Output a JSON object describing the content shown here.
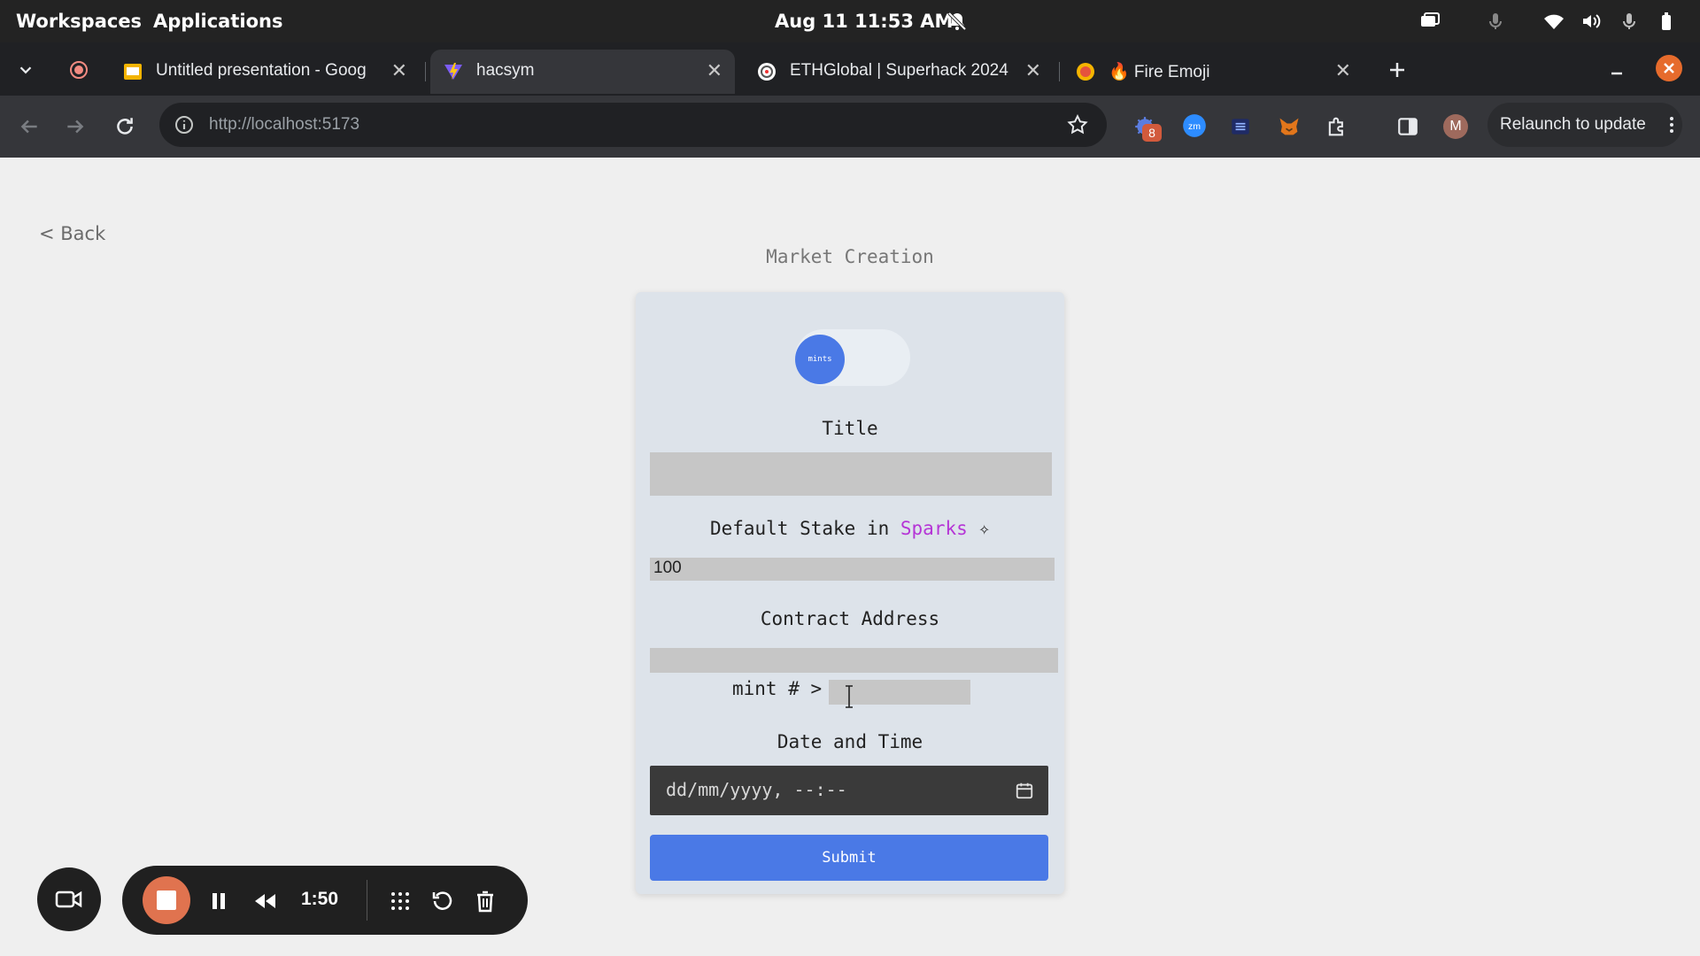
{
  "system_bar": {
    "workspaces": "Workspaces",
    "applications": "Applications",
    "clock": "Aug 11  11:53 AM"
  },
  "tabs": [
    {
      "title": "Untitled presentation - Goog",
      "favicon": "slides-icon",
      "active": false
    },
    {
      "title": "hacsym",
      "favicon": "vite-icon",
      "active": true
    },
    {
      "title": "ETHGlobal | Superhack 2024",
      "favicon": "ethglobal-icon",
      "active": false
    },
    {
      "title": "🔥 Fire Emoji",
      "favicon": "emoji-icon",
      "active": false
    }
  ],
  "toolbar": {
    "url": "http://localhost:5173",
    "relaunch_label": "Relaunch to update",
    "extension_badge": "8",
    "profile_initial": "M"
  },
  "page": {
    "back_link": "< Back",
    "title": "Market Creation",
    "toggle_label": "mints",
    "title_label": "Title",
    "title_value": "",
    "stake_label_prefix": "Default Stake in ",
    "stake_label_currency": "Sparks",
    "stake_label_suffix": " ✧",
    "stake_value": "100",
    "contract_label": "Contract Address",
    "contract_value": "",
    "mint_label": "mint # >",
    "mint_value": "",
    "datetime_label": "Date and Time",
    "datetime_placeholder": "dd/mm/yyyy, --:--",
    "submit_label": "Submit"
  },
  "recorder": {
    "time": "1:50"
  },
  "colors": {
    "accent": "#4a79e6",
    "sparks": "#b535d6",
    "record": "#e0734f"
  }
}
